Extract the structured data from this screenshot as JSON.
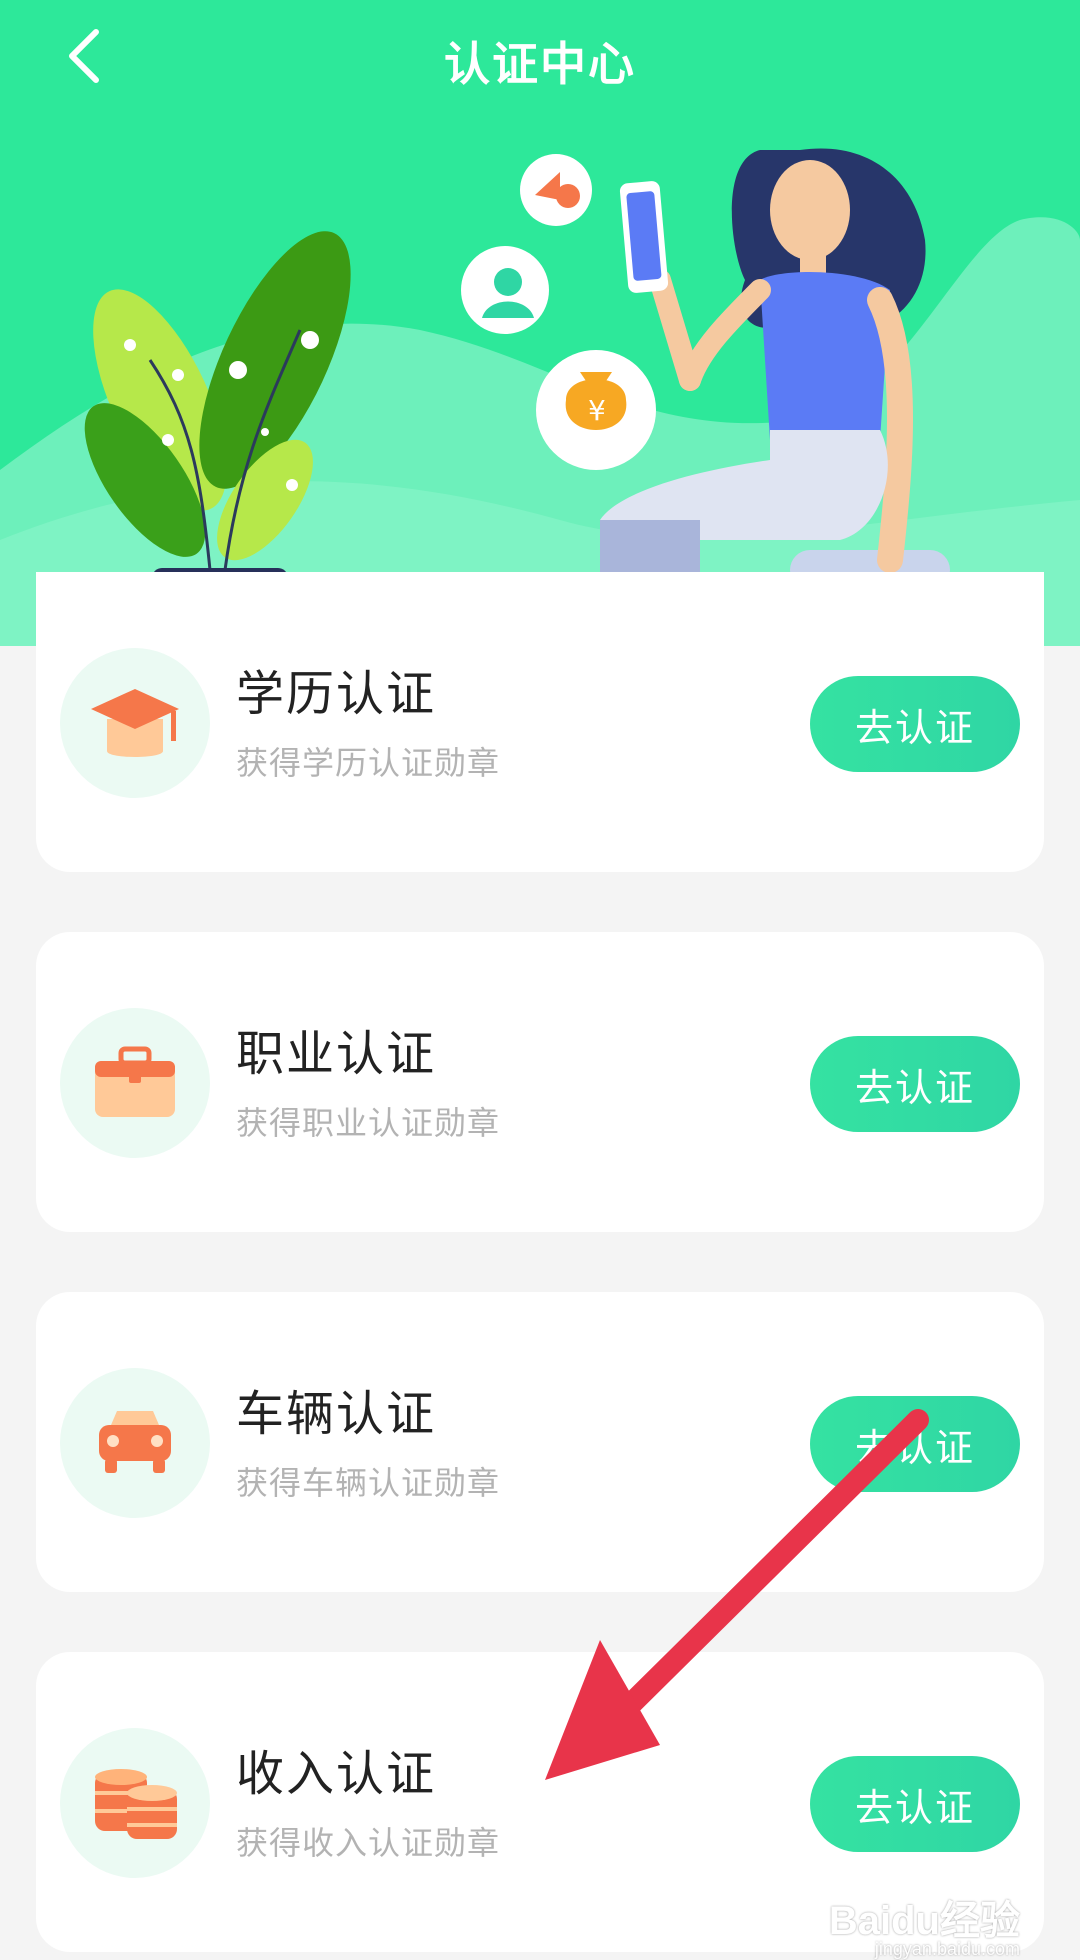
{
  "header": {
    "title": "认证中心",
    "back_icon": "chevron-left-icon",
    "background_color": "#2de89a"
  },
  "cards": [
    {
      "title": "学历认证",
      "subtitle": "获得学历认证勋章",
      "button": "去认证",
      "icon": "graduation-cap-icon"
    },
    {
      "title": "职业认证",
      "subtitle": "获得职业认证勋章",
      "button": "去认证",
      "icon": "briefcase-icon"
    },
    {
      "title": "车辆认证",
      "subtitle": "获得车辆认证勋章",
      "button": "去认证",
      "icon": "car-icon"
    },
    {
      "title": "收入认证",
      "subtitle": "获得收入认证勋章",
      "button": "去认证",
      "icon": "coins-icon"
    }
  ],
  "watermark": {
    "brand": "Baidu经验",
    "url": "jingyan.baidu.com"
  },
  "colors": {
    "accent": "#2fdca6",
    "annotation_arrow": "#e8344a",
    "icon_orange": "#f5774a"
  }
}
